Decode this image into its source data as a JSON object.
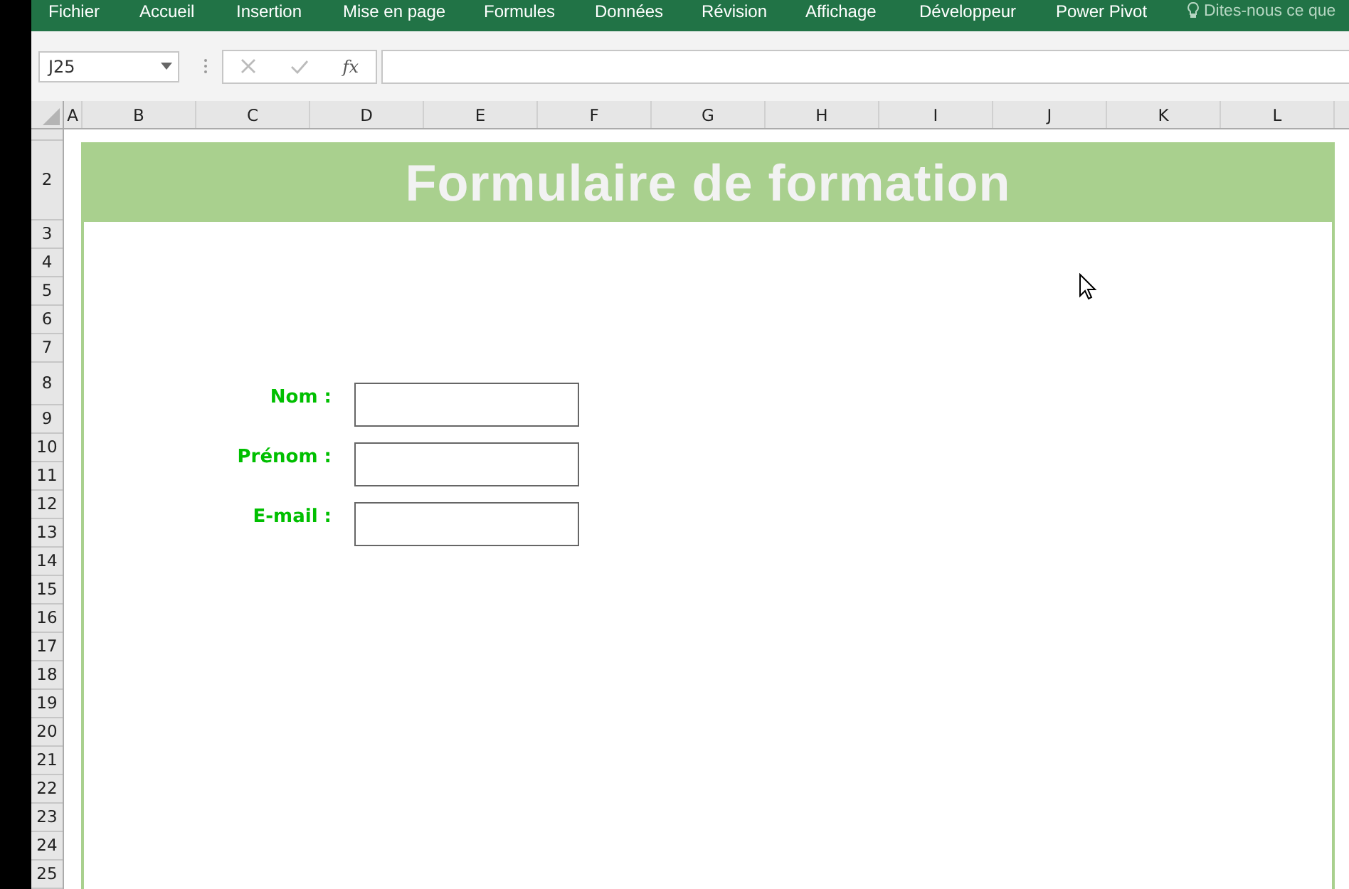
{
  "ribbon": {
    "tabs": [
      {
        "label": "Fichier"
      },
      {
        "label": "Accueil"
      },
      {
        "label": "Insertion"
      },
      {
        "label": "Mise en page"
      },
      {
        "label": "Formules"
      },
      {
        "label": "Données"
      },
      {
        "label": "Révision"
      },
      {
        "label": "Affichage"
      },
      {
        "label": "Développeur"
      },
      {
        "label": "Power Pivot"
      }
    ],
    "tell_me": "Dites-nous ce que"
  },
  "formula_bar": {
    "name_box": "J25",
    "function_button": "fx"
  },
  "columns": [
    "A",
    "B",
    "C",
    "D",
    "E",
    "F",
    "G",
    "H",
    "I",
    "J",
    "K",
    "L"
  ],
  "rows": [
    "2",
    "3",
    "4",
    "5",
    "6",
    "7",
    "8",
    "9",
    "10",
    "11",
    "12",
    "13",
    "14",
    "15",
    "16",
    "17",
    "18",
    "19",
    "20",
    "21",
    "22",
    "23",
    "24",
    "25"
  ],
  "form": {
    "title": "Formulaire de formation",
    "fields": [
      {
        "label": "Nom :"
      },
      {
        "label": "Prénom :"
      },
      {
        "label": "E-mail :"
      }
    ]
  }
}
